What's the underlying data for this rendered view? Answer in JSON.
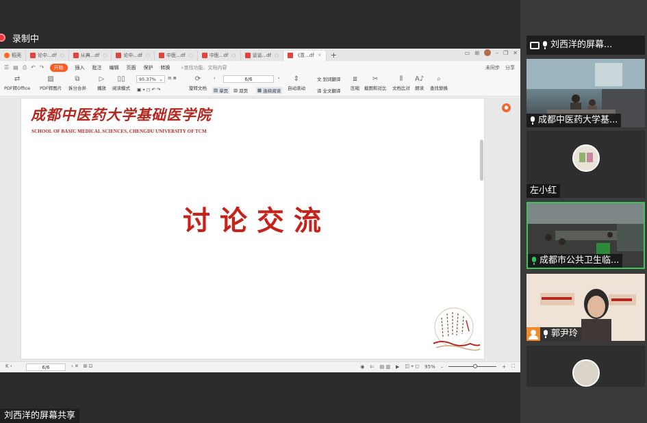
{
  "recording": {
    "label": "录制中"
  },
  "share_label": "刘西洋的屏幕共享",
  "app": {
    "tabs": [
      {
        "label": "稻壳",
        "type": "home"
      },
      {
        "label": "论中...df"
      },
      {
        "label": "从典...df"
      },
      {
        "label": "论中...df"
      },
      {
        "label": "中医...df"
      },
      {
        "label": "中医...df"
      },
      {
        "label": "谈谈...df"
      },
      {
        "label": "《意...df",
        "active": true
      }
    ],
    "menu": {
      "start": "开始",
      "items": [
        "插入",
        "批注",
        "编辑",
        "页面",
        "保护",
        "转换"
      ],
      "search": "查找功能、文档内容",
      "right": [
        "未同步",
        "分享"
      ]
    },
    "toolbar": {
      "pdf_to_office": "PDF转Office",
      "pdf_to_image": "PDF转图片",
      "split_merge": "拆分合并",
      "play": "播放",
      "read_mode": "阅读模式",
      "zoom": "95.37%",
      "page": "6/6",
      "rotate": "旋转文档",
      "single": "单页",
      "double": "双页",
      "continuous": "连续阅读",
      "auto_scroll": "自动滚动",
      "translate": "划词翻译",
      "full_translate": "全文翻译",
      "compress": "压缩",
      "screenshot": "截图和对比",
      "compare": "文档比对",
      "read_aloud": "朗读",
      "find_replace": "查找替换"
    },
    "status": {
      "page": "6/6",
      "zoom": "95%"
    }
  },
  "slide": {
    "university_cn": "成都中医药大学基础医学院",
    "university_en": "SCHOOL OF BASIC MEDICAL SCIENCES, CHENGDU UNIVERSITY OF TCM",
    "title": "讨论交流"
  },
  "participants": [
    {
      "name": "刘西洋的屏幕...",
      "mic": "on",
      "sharing": true
    },
    {
      "name": "成都中医药大学基...",
      "mic": "muted"
    },
    {
      "name": "左小红",
      "mic": "none"
    },
    {
      "name": "成都市公共卫生临...",
      "mic": "speaking",
      "active_speaker": true
    },
    {
      "name": "郭尹玲",
      "mic": "muted"
    },
    {
      "name": "",
      "mic": "none"
    }
  ],
  "colors": {
    "accent_red": "#c4221a",
    "speaker_border": "#3fc35b",
    "wps_orange": "#ff5a1f"
  }
}
